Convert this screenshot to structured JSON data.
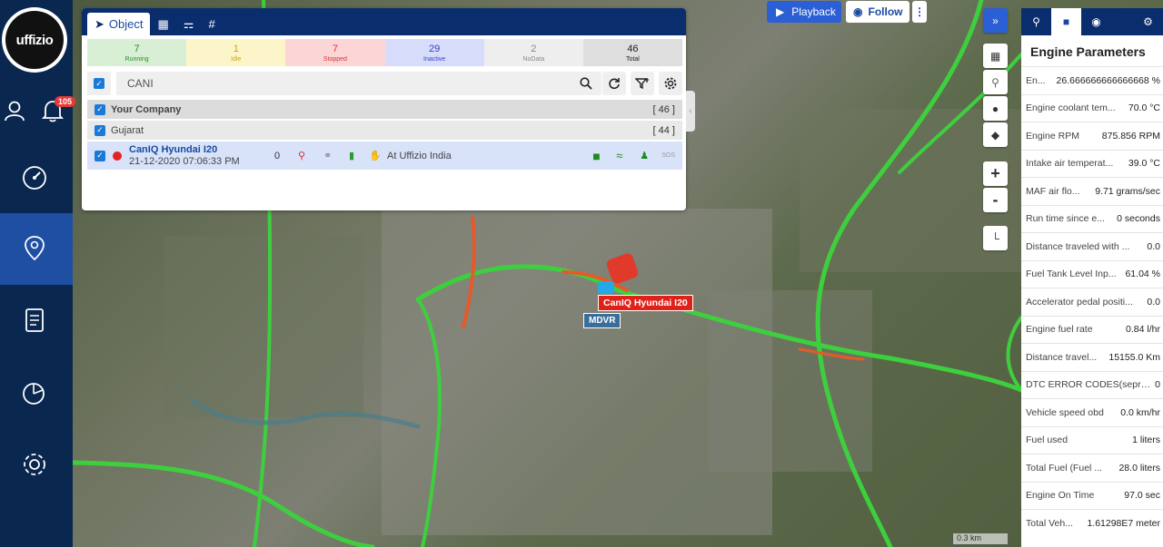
{
  "nav": {
    "logo_text": "uffizio",
    "notification_count": "105",
    "items": [
      "user-icon",
      "bell-icon",
      "dashboard-icon",
      "tracking-icon",
      "reports-icon",
      "analytics-icon",
      "settings-icon"
    ]
  },
  "object_panel": {
    "tabs": [
      {
        "label": "Object"
      }
    ],
    "stats": [
      {
        "count": "7",
        "label": "Running",
        "bg": "#d9efd5",
        "color": "#2b8a2b"
      },
      {
        "count": "1",
        "label": "Idle",
        "bg": "#fcf5c9",
        "color": "#c7a21b"
      },
      {
        "count": "7",
        "label": "Stopped",
        "bg": "#fcd6d6",
        "color": "#d63535"
      },
      {
        "count": "29",
        "label": "Inactive",
        "bg": "#d8dcfb",
        "color": "#3140c7"
      },
      {
        "count": "2",
        "label": "NoData",
        "bg": "#eeeeee",
        "color": "#888888"
      },
      {
        "count": "46",
        "label": "Total",
        "bg": "#dedede",
        "color": "#222222"
      }
    ],
    "search_value": "CANI",
    "company": {
      "name": "Your Company",
      "count": "[ 46 ]"
    },
    "group": {
      "name": "Gujarat",
      "count": "[ 44 ]"
    },
    "vehicle": {
      "name": "CanIQ Hyundai I20",
      "datetime": "21-12-2020 07:06:33 PM",
      "speed": "0",
      "location": "At Uffizio India",
      "sos": "SOS"
    }
  },
  "top_buttons": {
    "playback": "Playback",
    "follow": "Follow"
  },
  "map": {
    "vehicle_label": "CanIQ Hyundai I20",
    "mdvr_label": "MDVR",
    "scale": "0.3 km",
    "zoom_in": "+",
    "zoom_out": "-"
  },
  "engine": {
    "title": "Engine Parameters",
    "params": [
      {
        "label": "En...",
        "value": "26.666666666666668 %"
      },
      {
        "label": "Engine coolant tem...",
        "value": "70.0 °C"
      },
      {
        "label": "Engine RPM",
        "value": "875.856 RPM"
      },
      {
        "label": "Intake air temperat...",
        "value": "39.0 °C"
      },
      {
        "label": "MAF air flo...",
        "value": "9.71 grams/sec"
      },
      {
        "label": "Run time since e...",
        "value": "0 seconds"
      },
      {
        "label": "Distance traveled with ...",
        "value": "0.0"
      },
      {
        "label": "Fuel Tank Level Inp...",
        "value": "61.04 %"
      },
      {
        "label": "Accelerator pedal positi...",
        "value": "0.0"
      },
      {
        "label": "Engine fuel rate",
        "value": "0.84 l/hr"
      },
      {
        "label": "Distance travel...",
        "value": "15155.0 Km"
      },
      {
        "label": "DTC ERROR CODES(sepra...",
        "value": "0"
      },
      {
        "label": "Vehicle speed obd",
        "value": "0.0 km/hr"
      },
      {
        "label": "Fuel used",
        "value": "1 liters"
      },
      {
        "label": "Total Fuel (Fuel ...",
        "value": "28.0 liters"
      },
      {
        "label": "Engine On Time",
        "value": "97.0 sec"
      },
      {
        "label": "Total Veh...",
        "value": "1.61298E7 meter"
      }
    ]
  }
}
